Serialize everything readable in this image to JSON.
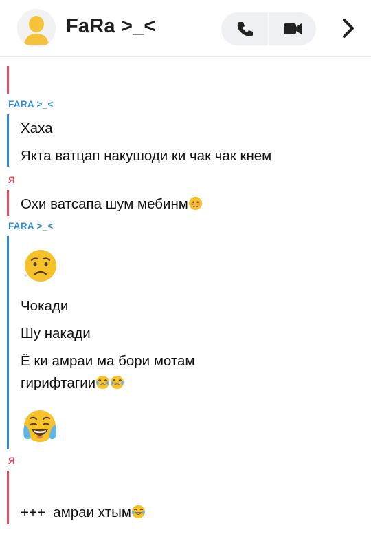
{
  "header": {
    "title": "FaRa >_<",
    "icons": {
      "avatar": "avatar-icon",
      "phone": "phone-icon",
      "video": "video-camera-icon",
      "chevron": "chevron-right-icon"
    }
  },
  "messages": [
    {
      "sender": "FARA >_<",
      "text": "Хаха"
    },
    {
      "text": "Якта ватцап накушоди ки чак чак кнем"
    },
    {
      "sender": "Я",
      "text": "Охи ватсапа шум мебинм"
    },
    {
      "sender": "FARA >_<",
      "text": "Чокади"
    },
    {
      "text": "Шу накади"
    },
    {
      "text": "Ё ки амраи ма бори мотам"
    },
    {
      "text": "гирифтагии"
    },
    {
      "sender": "Я",
      "text": "+++  амраи хтым"
    }
  ],
  "colors": {
    "me": "#e54a5e",
    "fara": "#2f8bd8",
    "emoji": "#f6c22b"
  }
}
